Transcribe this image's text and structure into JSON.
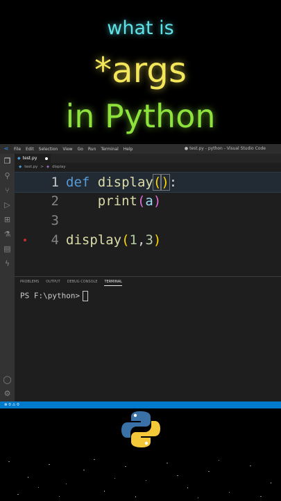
{
  "title": {
    "line1": "what is",
    "line2": "*args",
    "line3": "in Python"
  },
  "vscode": {
    "menu": [
      "File",
      "Edit",
      "Selection",
      "View",
      "Go",
      "Run",
      "Terminal",
      "Help"
    ],
    "window_title": "● test.py - python - Visual Studio Code",
    "tab": {
      "label": "test.py"
    },
    "breadcrumb": {
      "file": "test.py",
      "sep": ">",
      "symbol": "display"
    },
    "editor": {
      "lines": [
        {
          "num": "1",
          "def": "def",
          "name": "display",
          "open": "(",
          "close": ")",
          "colon": ":"
        },
        {
          "num": "2",
          "indent": "    ",
          "name": "print",
          "open": "(",
          "arg": "a",
          "close": ")"
        },
        {
          "num": "3"
        },
        {
          "num": "4",
          "name": "display",
          "open": "(",
          "a1": "1",
          "comma": ",",
          "a2": "3",
          "close": ")"
        }
      ]
    },
    "panel": {
      "tabs": [
        "PROBLEMS",
        "OUTPUT",
        "DEBUG CONSOLE",
        "TERMINAL"
      ],
      "terminal_prompt": "PS F:\\python>"
    },
    "status": {
      "errors": "⊗ 0 ⚠ 0"
    },
    "colors": {
      "accent": "#007acc",
      "keyword": "#569cd6",
      "function": "#dcdcaa",
      "bracket": "#ffd700"
    }
  }
}
